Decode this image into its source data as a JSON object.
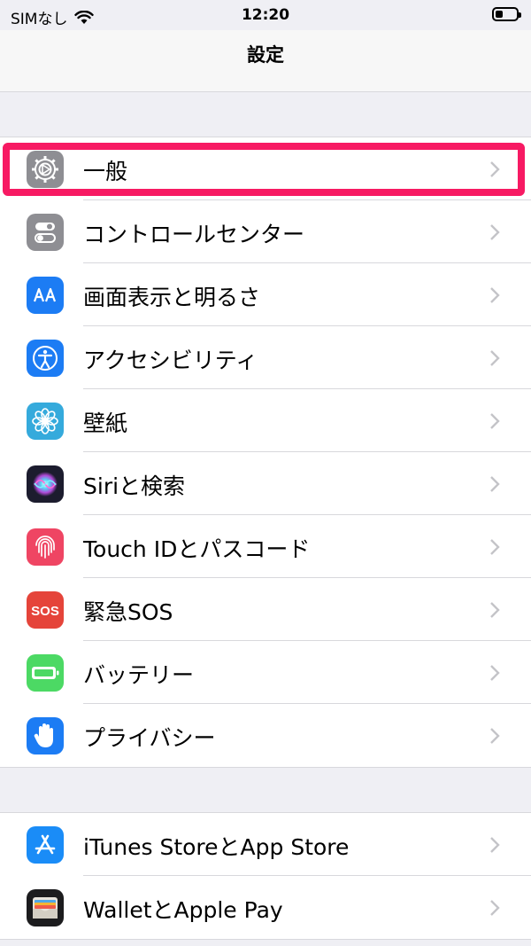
{
  "status_bar": {
    "carrier": "SIMなし",
    "time": "12:20",
    "battery_level": 0.35
  },
  "nav": {
    "title": "設定"
  },
  "groups": [
    {
      "items": [
        {
          "label": "一般",
          "icon": "gear-icon",
          "color": "#8e8e93"
        },
        {
          "label": "コントロールセンター",
          "icon": "control-center-icon",
          "color": "#8e8e93"
        },
        {
          "label": "画面表示と明るさ",
          "icon": "display-brightness-icon",
          "color": "#1c7cf4"
        },
        {
          "label": "アクセシビリティ",
          "icon": "accessibility-icon",
          "color": "#1c7cf4"
        },
        {
          "label": "壁紙",
          "icon": "wallpaper-flower-icon",
          "color": "#35aadc"
        },
        {
          "label": "Siriと検索",
          "icon": "siri-icon",
          "color": "#1c1c2e"
        },
        {
          "label": "Touch IDとパスコード",
          "icon": "fingerprint-icon",
          "color": "#ef4563"
        },
        {
          "label": "緊急SOS",
          "icon": "sos-icon",
          "color": "#e5443a"
        },
        {
          "label": "バッテリー",
          "icon": "battery-icon",
          "color": "#4cd964"
        },
        {
          "label": "プライバシー",
          "icon": "hand-icon",
          "color": "#1c7cf4"
        }
      ]
    },
    {
      "items": [
        {
          "label": "iTunes StoreとApp Store",
          "icon": "app-store-icon",
          "color": "#1a8cf7"
        },
        {
          "label": "WalletとApple Pay",
          "icon": "wallet-icon",
          "color": "#1c1c1e"
        }
      ]
    }
  ],
  "highlight_color": "#f71a63"
}
